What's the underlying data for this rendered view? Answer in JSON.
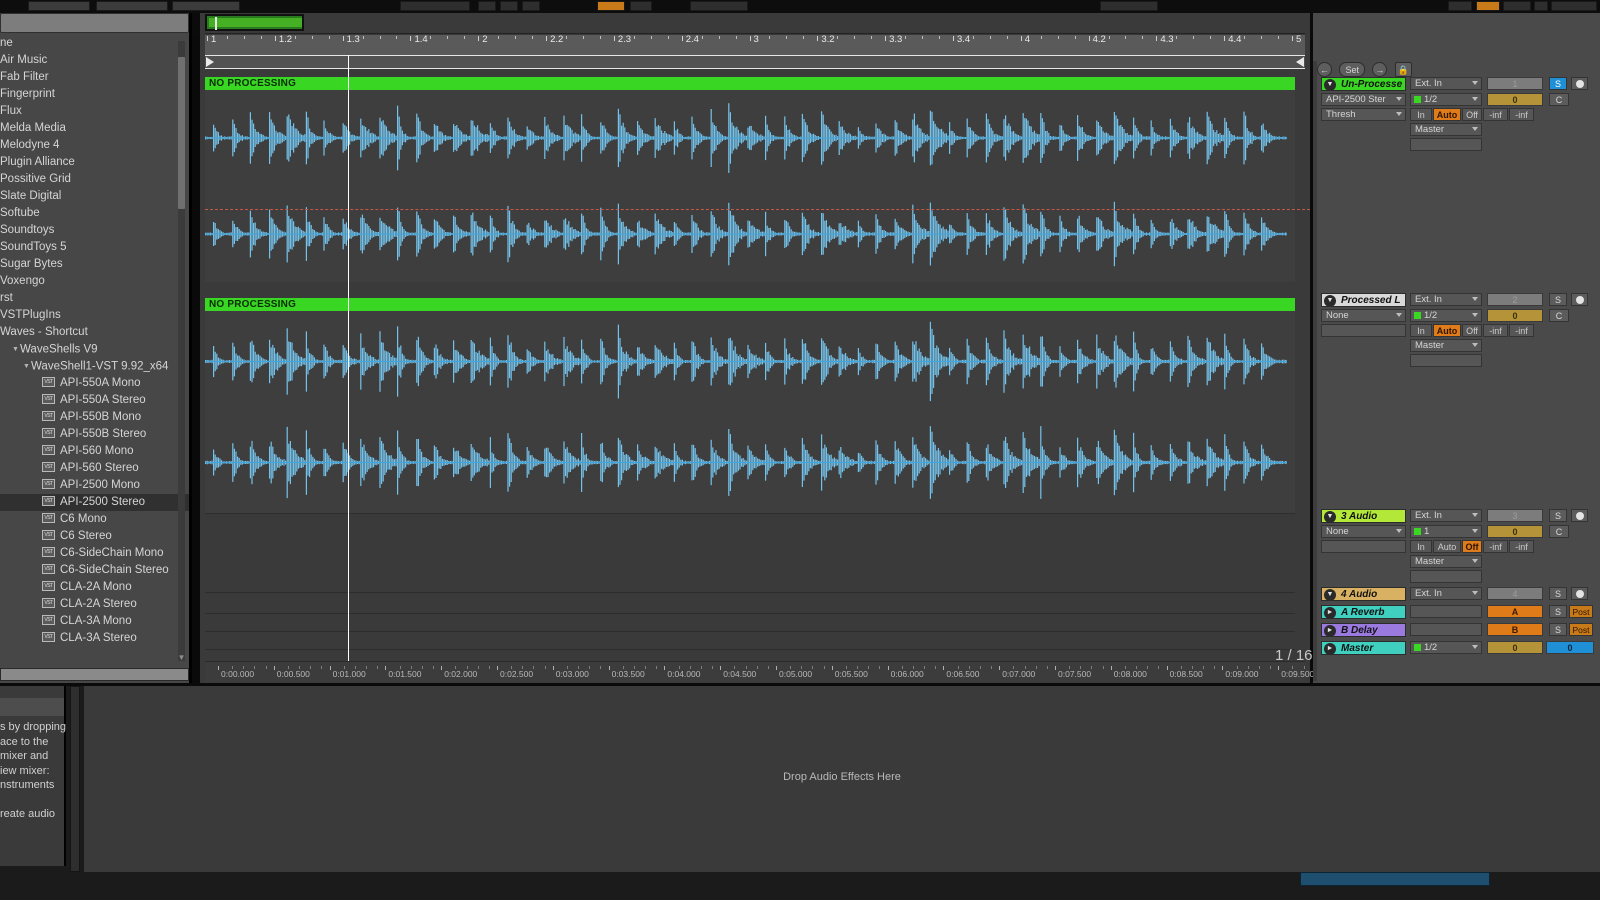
{
  "app": {
    "title": "Ableton Live Arrangement View"
  },
  "browser": {
    "search_placeholder": "",
    "items": [
      {
        "label": "ne",
        "indent": 0,
        "icon": null,
        "selected": false
      },
      {
        "label": "Air Music",
        "indent": 0,
        "icon": null,
        "selected": false
      },
      {
        "label": "Fab Filter",
        "indent": 0,
        "icon": null,
        "selected": false
      },
      {
        "label": "Fingerprint",
        "indent": 0,
        "icon": null,
        "selected": false
      },
      {
        "label": "Flux",
        "indent": 0,
        "icon": null,
        "selected": false
      },
      {
        "label": "Melda Media",
        "indent": 0,
        "icon": null,
        "selected": false
      },
      {
        "label": "Melodyne 4",
        "indent": 0,
        "icon": null,
        "selected": false
      },
      {
        "label": "Plugin Alliance",
        "indent": 0,
        "icon": null,
        "selected": false
      },
      {
        "label": "Possitive Grid",
        "indent": 0,
        "icon": null,
        "selected": false
      },
      {
        "label": "Slate Digital",
        "indent": 0,
        "icon": null,
        "selected": false
      },
      {
        "label": "Softube",
        "indent": 0,
        "icon": null,
        "selected": false
      },
      {
        "label": "Soundtoys",
        "indent": 0,
        "icon": null,
        "selected": false
      },
      {
        "label": "SoundToys 5",
        "indent": 0,
        "icon": null,
        "selected": false
      },
      {
        "label": "Sugar Bytes",
        "indent": 0,
        "icon": null,
        "selected": false
      },
      {
        "label": "Voxengo",
        "indent": 0,
        "icon": null,
        "selected": false
      },
      {
        "label": "rst",
        "indent": 0,
        "icon": null,
        "selected": false
      },
      {
        "label": "VSTPlugIns",
        "indent": 0,
        "icon": null,
        "selected": false
      },
      {
        "label": "Waves - Shortcut",
        "indent": 0,
        "icon": null,
        "selected": false
      },
      {
        "label": "WaveShells V9",
        "indent": 1,
        "icon": "folder-open-triangle",
        "selected": false
      },
      {
        "label": "WaveShell1-VST 9.92_x64",
        "indent": 2,
        "icon": "folder-open-triangle",
        "selected": false
      },
      {
        "label": "API-550A Mono",
        "indent": 3,
        "icon": "vst-plugin-icon",
        "selected": false
      },
      {
        "label": "API-550A Stereo",
        "indent": 3,
        "icon": "vst-plugin-icon",
        "selected": false
      },
      {
        "label": "API-550B Mono",
        "indent": 3,
        "icon": "vst-plugin-icon",
        "selected": false
      },
      {
        "label": "API-550B Stereo",
        "indent": 3,
        "icon": "vst-plugin-icon",
        "selected": false
      },
      {
        "label": "API-560 Mono",
        "indent": 3,
        "icon": "vst-plugin-icon",
        "selected": false
      },
      {
        "label": "API-560 Stereo",
        "indent": 3,
        "icon": "vst-plugin-icon",
        "selected": false
      },
      {
        "label": "API-2500 Mono",
        "indent": 3,
        "icon": "vst-plugin-icon",
        "selected": false
      },
      {
        "label": "API-2500 Stereo",
        "indent": 3,
        "icon": "vst-plugin-icon",
        "selected": true
      },
      {
        "label": "C6 Mono",
        "indent": 3,
        "icon": "vst-plugin-icon",
        "selected": false
      },
      {
        "label": "C6 Stereo",
        "indent": 3,
        "icon": "vst-plugin-icon",
        "selected": false
      },
      {
        "label": "C6-SideChain Mono",
        "indent": 3,
        "icon": "vst-plugin-icon",
        "selected": false
      },
      {
        "label": "C6-SideChain Stereo",
        "indent": 3,
        "icon": "vst-plugin-icon",
        "selected": false
      },
      {
        "label": "CLA-2A Mono",
        "indent": 3,
        "icon": "vst-plugin-icon",
        "selected": false
      },
      {
        "label": "CLA-2A Stereo",
        "indent": 3,
        "icon": "vst-plugin-icon",
        "selected": false
      },
      {
        "label": "CLA-3A Mono",
        "indent": 3,
        "icon": "vst-plugin-icon",
        "selected": false
      },
      {
        "label": "CLA-3A Stereo",
        "indent": 3,
        "icon": "vst-plugin-icon",
        "selected": false
      }
    ]
  },
  "arrangement": {
    "bar_ticks": [
      "1",
      "1.2",
      "1.3",
      "1.4",
      "2",
      "2.2",
      "2.3",
      "2.4",
      "3",
      "3.2",
      "3.3",
      "3.4",
      "4",
      "4.2",
      "4.3",
      "4.4",
      "5"
    ],
    "time_ticks": [
      "0:00.000",
      "0:00.500",
      "0:01.000",
      "0:01.500",
      "0:02.000",
      "0:02.500",
      "0:03.000",
      "0:03.500",
      "0:04.000",
      "0:04.500",
      "0:05.000",
      "0:05.500",
      "0:06.000",
      "0:06.500",
      "0:07.000",
      "0:07.500",
      "0:08.000",
      "0:08.500",
      "0:09.000",
      "0:09.500"
    ],
    "grid_indicator": "1 / 16",
    "clips": [
      {
        "name": "NO PROCESSING",
        "color": "#3ad624"
      },
      {
        "name": "NO PROCESSING",
        "color": "#3ad624"
      }
    ]
  },
  "mixer": {
    "toolbar": {
      "back_icon": "arrow-left-icon",
      "set_label": "Set",
      "forward_icon": "arrow-right-icon",
      "lock_icon": "lock-icon"
    },
    "add_track_icon": "plus-icon",
    "tracks": [
      {
        "name": "Un-Processe",
        "color": "#3ad624",
        "device": "API-2500 Ster",
        "param": "Thresh",
        "input": "Ext. In",
        "channel": "1/2",
        "monitor": [
          "In",
          "Auto",
          "Off"
        ],
        "monitor_active": "Auto",
        "output": "Master",
        "sub_output": "",
        "number": "1",
        "volume": "0",
        "meter_left": "-inf",
        "meter_right": "-inf",
        "solo": "S",
        "solo_active": true,
        "crossfade": "C",
        "rec_icon": "record-icon",
        "type": "audio"
      },
      {
        "name": "Processed L",
        "color": "#d9d9d9",
        "device": "None",
        "param": "",
        "input": "Ext. In",
        "channel": "1/2",
        "monitor": [
          "In",
          "Auto",
          "Off"
        ],
        "monitor_active": "Auto",
        "output": "Master",
        "sub_output": "",
        "number": "2",
        "volume": "0",
        "meter_left": "-inf",
        "meter_right": "-inf",
        "solo": "S",
        "solo_active": false,
        "crossfade": "C",
        "rec_icon": "record-icon",
        "type": "audio"
      },
      {
        "name": "3 Audio",
        "color": "#b3e838",
        "device": "None",
        "param": "",
        "input": "Ext. In",
        "channel": "1",
        "monitor": [
          "In",
          "Auto",
          "Off"
        ],
        "monitor_active": "Off",
        "output": "Master",
        "sub_output": "",
        "number": "3",
        "volume": "0",
        "meter_left": "-inf",
        "meter_right": "-inf",
        "solo": "S",
        "solo_active": false,
        "crossfade": "C",
        "rec_icon": "record-icon",
        "type": "audio"
      },
      {
        "name": "4 Audio",
        "color": "#d9b163",
        "input": "Ext. In",
        "number": "4",
        "solo": "S",
        "rec_icon": "record-icon",
        "type": "audio"
      }
    ],
    "returns": [
      {
        "name": "A Reverb",
        "color": "#3fd0c0",
        "letter": "A",
        "solo": "S",
        "post": "Post",
        "play_icon": "play-icon"
      },
      {
        "name": "B Delay",
        "color": "#9b7ae0",
        "letter": "B",
        "solo": "S",
        "post": "Post",
        "play_icon": "play-icon"
      }
    ],
    "master": {
      "name": "Master",
      "color": "#3fd0c0",
      "channel": "1/2",
      "volume": "0",
      "pan": "0",
      "play_icon": "play-icon"
    }
  },
  "bottom": {
    "help_lines": [
      "s by dropping",
      "ace to the",
      "mixer and",
      "iew mixer:",
      "nstruments",
      "",
      "reate audio"
    ],
    "drop_label": "Drop Audio Effects Here"
  }
}
